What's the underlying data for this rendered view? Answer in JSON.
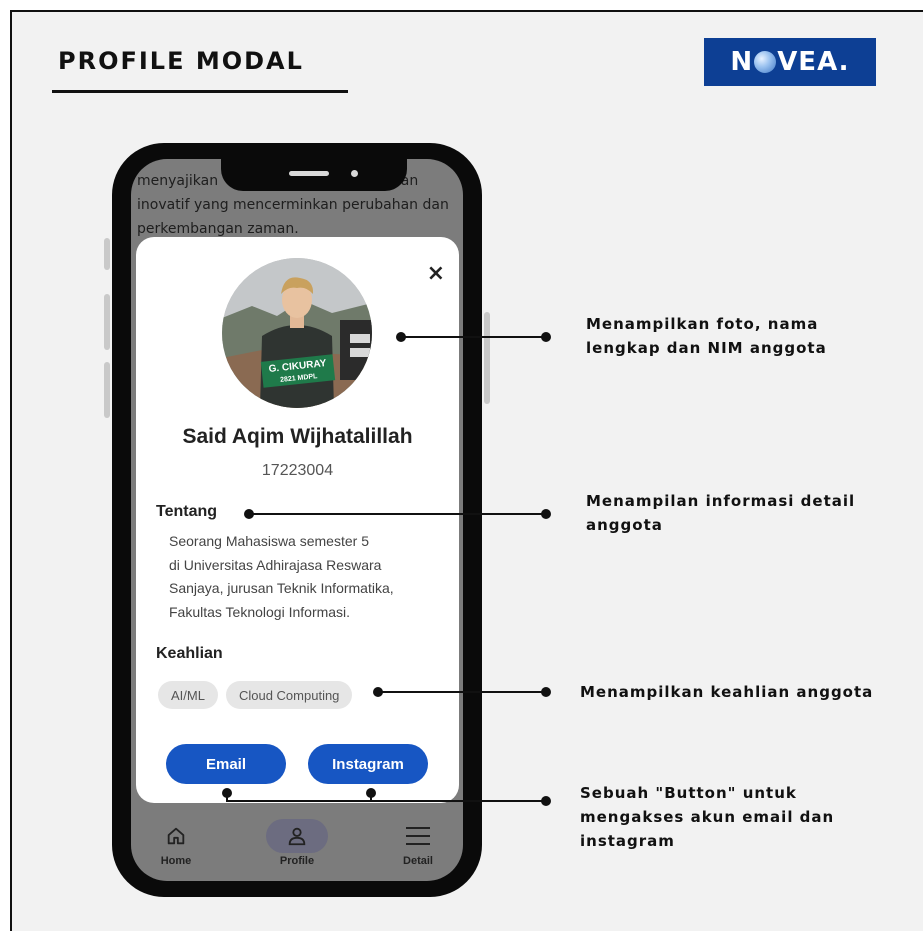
{
  "page_title": "PROFILE MODAL",
  "brand": {
    "name_pre": "N",
    "name_post": "VEA.",
    "icon": "globe-icon",
    "color": "#0d3f94"
  },
  "background_text": [
    "menyajikan",
    "n, dan",
    "inovatif yang mencerminkan perubahan dan",
    "perkembangan zaman."
  ],
  "modal": {
    "close_label": "×",
    "name": "Said Aqim Wijhatalillah",
    "nim": "17223004",
    "about_label": "Tentang",
    "about_lines": [
      "Seorang Mahasiswa semester 5",
      "di Universitas Adhirajasa Reswara",
      "Sanjaya, jurusan Teknik Informatika,",
      "Fakultas Teknologi Informasi."
    ],
    "skills_label": "Keahlian",
    "skills": [
      "AI/ML",
      "Cloud Computing"
    ],
    "email_button": "Email",
    "instagram_button": "Instagram",
    "accent": "#1756c3"
  },
  "photo_banner": {
    "line1": "G. CIKURAY",
    "line2": "2821 MDPL"
  },
  "nav": {
    "home": {
      "label": "Home",
      "icon": "home-icon"
    },
    "profile": {
      "label": "Profile",
      "icon": "user-icon"
    },
    "detail": {
      "label": "Detail",
      "icon": "menu-icon"
    }
  },
  "annotations": {
    "photo": [
      "Menampilkan foto, nama",
      "lengkap dan NIM anggota"
    ],
    "detail": [
      "Menampilan informasi detail",
      "anggota"
    ],
    "skills": [
      "Menampilkan keahlian anggota"
    ],
    "buttons": [
      "Sebuah \"Button\" untuk",
      "mengakses akun email dan",
      "instagram"
    ]
  }
}
